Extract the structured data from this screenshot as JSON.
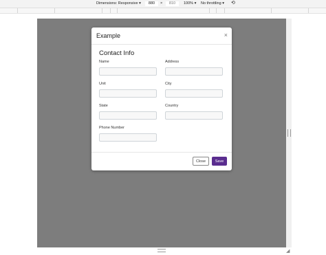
{
  "devtools": {
    "dimensions_label": "Dimensions: Responsive",
    "width": "880",
    "times": "×",
    "height": "810",
    "zoom": "100%",
    "throttling": "No throttling",
    "rotate_icon": "rotate-icon"
  },
  "modal": {
    "title": "Example",
    "close_symbol": "×",
    "section_title": "Contact Info",
    "fields": {
      "name": {
        "label": "Name",
        "value": ""
      },
      "address": {
        "label": "Address",
        "value": ""
      },
      "unit": {
        "label": "Unit",
        "value": ""
      },
      "city": {
        "label": "City",
        "value": ""
      },
      "state": {
        "label": "State",
        "value": ""
      },
      "country": {
        "label": "Country",
        "value": ""
      },
      "phone": {
        "label": "Phone Number",
        "value": ""
      }
    },
    "buttons": {
      "close": "Close",
      "save": "Save"
    }
  },
  "colors": {
    "accent": "#5a2d8f",
    "backdrop": "#7d7d7d"
  }
}
